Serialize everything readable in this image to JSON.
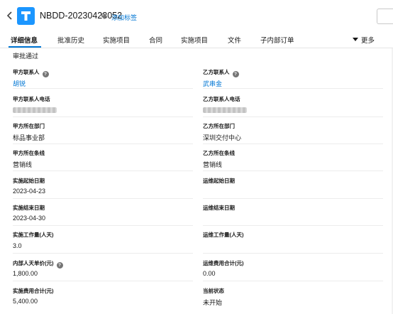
{
  "header": {
    "record_title": "NBDD-20230423052",
    "add_tag_label": "添加标签",
    "app_icon_letter": "T"
  },
  "tabs": [
    {
      "label": "详细信息"
    },
    {
      "label": "批准历史"
    },
    {
      "label": "实施项目"
    },
    {
      "label": "合同"
    },
    {
      "label": "实施项目"
    },
    {
      "label": "文件"
    },
    {
      "label": "子内部订单"
    }
  ],
  "more_label": "更多",
  "status_line": "审批通过",
  "fields": {
    "party_a_contact": {
      "label": "甲方联系人",
      "value": "胡锐"
    },
    "party_b_contact": {
      "label": "乙方联系人",
      "value": "武串金"
    },
    "party_a_phone": {
      "label": "甲方联系人电话"
    },
    "party_b_phone": {
      "label": "乙方联系人电话"
    },
    "party_a_dept": {
      "label": "甲方所在部门",
      "value": "标品事业部"
    },
    "party_b_dept": {
      "label": "乙方所在部门",
      "value": "深圳交付中心"
    },
    "party_a_line": {
      "label": "甲方所在条线",
      "value": "营销线"
    },
    "party_b_line": {
      "label": "乙方所在条线",
      "value": "营销线"
    },
    "impl_start": {
      "label": "实施起始日期",
      "value": "2023-04-23"
    },
    "ops_start": {
      "label": "运维起始日期",
      "value": ""
    },
    "impl_end": {
      "label": "实施结束日期",
      "value": "2023-04-30"
    },
    "ops_end": {
      "label": "运维结束日期",
      "value": ""
    },
    "impl_effort": {
      "label": "实施工作量(人天)",
      "value": "3.0"
    },
    "ops_effort": {
      "label": "运维工作量(人天)",
      "value": ""
    },
    "internal_rate": {
      "label": "内部人天单价(元)",
      "value": "1,800.00"
    },
    "ops_cost_total": {
      "label": "运维费用合计(元)",
      "value": "0.00"
    },
    "impl_cost_total": {
      "label": "实施费用合计(元)",
      "value": "5,400.00"
    },
    "current_status": {
      "label": "当前状态",
      "value": "未开始"
    }
  },
  "icons": {
    "back": "chevron-left-icon",
    "tag": "tag-icon",
    "help": "help-icon",
    "more": "triangle-down-icon"
  },
  "colors": {
    "accent": "#0176d3",
    "app_icon": "#1b96ff"
  }
}
